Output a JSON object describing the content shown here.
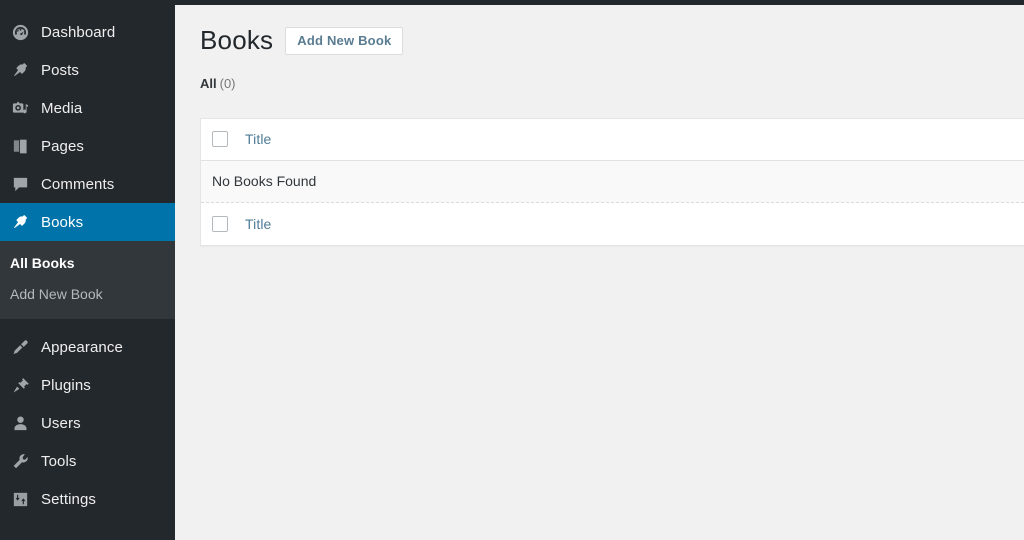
{
  "sidebar": {
    "items": [
      {
        "label": "Dashboard",
        "icon": "dashboard-icon",
        "current": false
      },
      {
        "label": "Posts",
        "icon": "pin-icon",
        "current": false
      },
      {
        "label": "Media",
        "icon": "media-icon",
        "current": false
      },
      {
        "label": "Pages",
        "icon": "pages-icon",
        "current": false
      },
      {
        "label": "Comments",
        "icon": "comments-icon",
        "current": false
      },
      {
        "label": "Books",
        "icon": "pin-icon",
        "current": true
      },
      {
        "label": "Appearance",
        "icon": "appearance-icon",
        "current": false
      },
      {
        "label": "Plugins",
        "icon": "plugins-icon",
        "current": false
      },
      {
        "label": "Users",
        "icon": "users-icon",
        "current": false
      },
      {
        "label": "Tools",
        "icon": "tools-icon",
        "current": false
      },
      {
        "label": "Settings",
        "icon": "settings-icon",
        "current": false
      }
    ],
    "submenu": [
      {
        "label": "All Books",
        "current": true
      },
      {
        "label": "Add New Book",
        "current": false
      }
    ]
  },
  "main": {
    "page_title": "Books",
    "add_new_label": "Add New Book",
    "filters": [
      {
        "label": "All",
        "count": "(0)"
      }
    ],
    "table": {
      "columns": {
        "title": "Title"
      },
      "empty_message": "No Books Found",
      "rows": []
    }
  },
  "colors": {
    "sidebar_bg": "#23282d",
    "submenu_bg": "#32373c",
    "accent_blue": "#0073aa",
    "link_blue": "#4f7c97",
    "content_bg": "#f1f1f1"
  }
}
